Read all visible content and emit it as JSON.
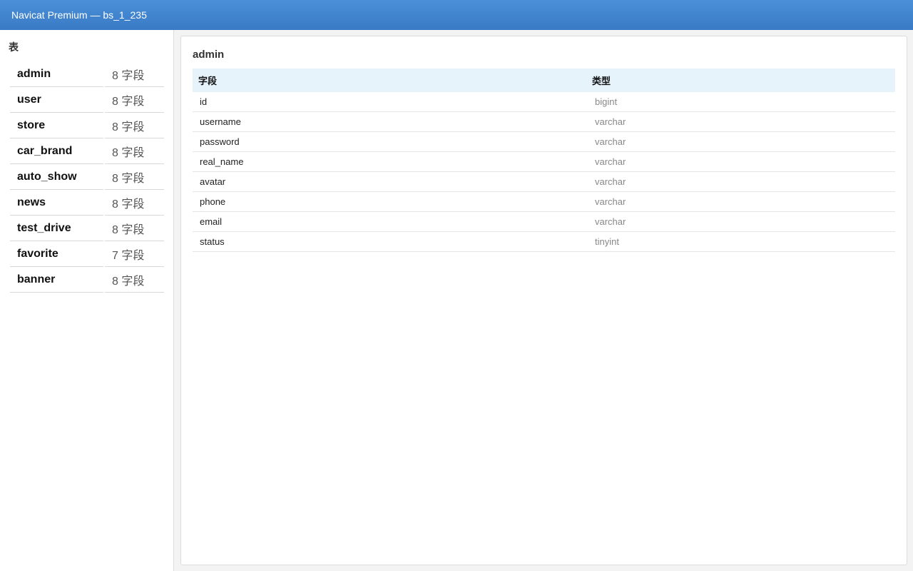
{
  "window": {
    "title": "Navicat Premium — bs_1_235"
  },
  "sidebar": {
    "heading": "表",
    "tables": [
      {
        "name": "admin",
        "count": "8 字段"
      },
      {
        "name": "user",
        "count": "8 字段"
      },
      {
        "name": "store",
        "count": "8 字段"
      },
      {
        "name": "car_brand",
        "count": "8 字段"
      },
      {
        "name": "auto_show",
        "count": "8 字段"
      },
      {
        "name": "news",
        "count": "8 字段"
      },
      {
        "name": "test_drive",
        "count": "8 字段"
      },
      {
        "name": "favorite",
        "count": "7 字段"
      },
      {
        "name": "banner",
        "count": "8 字段"
      }
    ]
  },
  "main": {
    "title": "admin",
    "columns": {
      "field": "字段",
      "type": "类型"
    },
    "rows": [
      {
        "field": "id",
        "type": "bigint"
      },
      {
        "field": "username",
        "type": "varchar"
      },
      {
        "field": "password",
        "type": "varchar"
      },
      {
        "field": "real_name",
        "type": "varchar"
      },
      {
        "field": "avatar",
        "type": "varchar"
      },
      {
        "field": "phone",
        "type": "varchar"
      },
      {
        "field": "email",
        "type": "varchar"
      },
      {
        "field": "status",
        "type": "tinyint"
      }
    ]
  },
  "colors": {
    "titlebar": "#4a90d9",
    "header_row": "#e6f3fb"
  }
}
